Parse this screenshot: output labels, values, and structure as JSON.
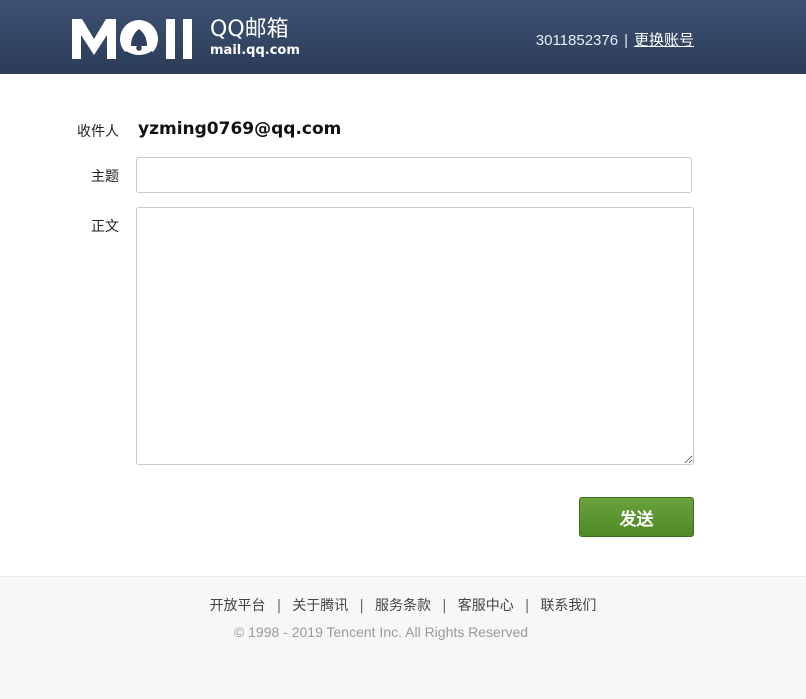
{
  "header": {
    "logo_brand": "QQ邮箱",
    "logo_domain": "mail.qq.com",
    "account_number": "3011852376",
    "separator": "|",
    "switch_account_label": "更换账号"
  },
  "form": {
    "recipient_label": "收件人",
    "recipient_value": "yzming0769@qq.com",
    "subject_label": "主题",
    "subject_value": "",
    "body_label": "正文",
    "body_value": "",
    "send_label": "发送"
  },
  "footer": {
    "links": [
      {
        "label": "开放平台"
      },
      {
        "label": "关于腾讯"
      },
      {
        "label": "服务条款"
      },
      {
        "label": "客服中心"
      },
      {
        "label": "联系我们"
      }
    ],
    "separator": "|",
    "copyright": "© 1998 - 2019 Tencent Inc. All Rights Reserved"
  },
  "colors": {
    "header_bg": "#2f4160",
    "send_button": "#5a9530",
    "footer_bg": "#f7f7f7"
  },
  "icons": {
    "logo": "mail-logo-icon"
  }
}
